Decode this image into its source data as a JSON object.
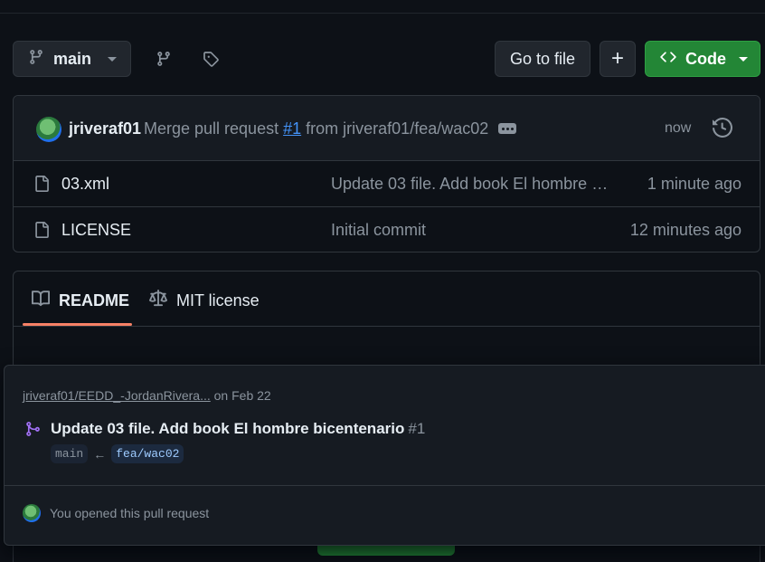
{
  "branch_selector": {
    "label": "main"
  },
  "toolbar": {
    "go_to_file": "Go to file",
    "add_label": "+",
    "code_label": "Code"
  },
  "commit": {
    "author": "jriveraf01",
    "message_prefix": "Merge pull request",
    "pr_link": "#1",
    "message_suffix": "from jriveraf01/fea/wac02",
    "time": "now"
  },
  "files": [
    {
      "name": "03.xml",
      "message": "Update 03 file. Add book El hombre bicentenario",
      "time": "1 minute ago"
    },
    {
      "name": "LICENSE",
      "message": "Initial commit",
      "time": "12 minutes ago"
    }
  ],
  "readme_tabs": {
    "readme": "README",
    "license": "MIT license"
  },
  "popover": {
    "repo": "jriveraf01/EEDD_-JordanRivera...",
    "date": "on Feb 22",
    "title": "Update 03 file. Add book El hombre bicentenario",
    "number": "#1",
    "base_branch": "main",
    "arrow": "←",
    "head_branch": "fea/wac02",
    "footer": "You opened this pull request"
  },
  "colors": {
    "background": "#0d1117",
    "accent_green": "#238636",
    "link_blue": "#4493f8",
    "tab_underline": "#f78166",
    "pr_purple": "#a371f7"
  }
}
